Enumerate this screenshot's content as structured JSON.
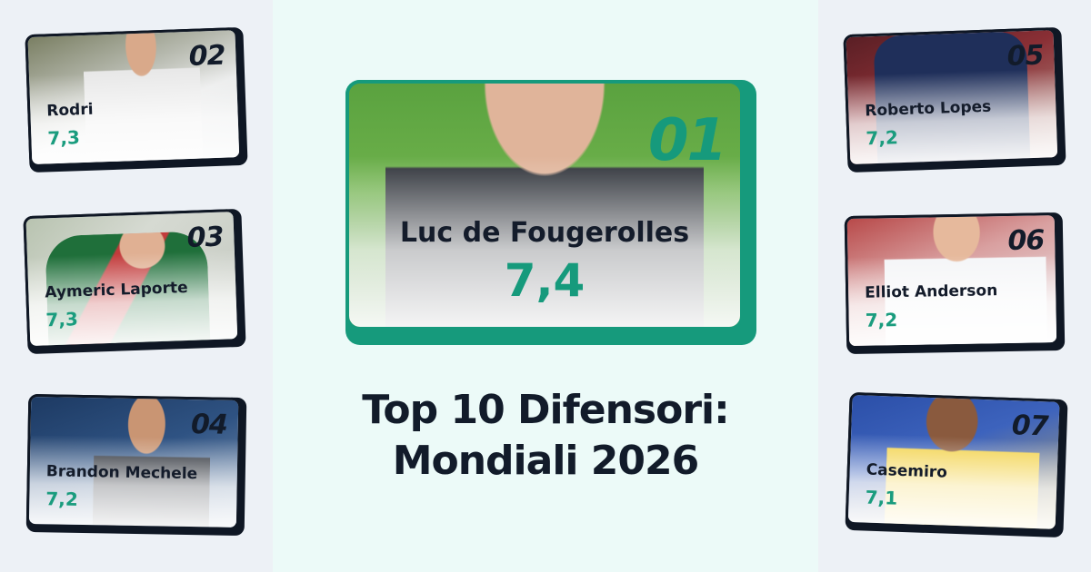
{
  "title": {
    "line1": "Top 10 Difensori:",
    "line2": "Mondiali 2026"
  },
  "featured": {
    "rank": "01",
    "name": "Luc de Fougerolles",
    "score": "7,4"
  },
  "players": [
    {
      "rank": "02",
      "name": "Rodri",
      "score": "7,3"
    },
    {
      "rank": "03",
      "name": "Aymeric Laporte",
      "score": "7,3"
    },
    {
      "rank": "04",
      "name": "Brandon Mechele",
      "score": "7,2"
    },
    {
      "rank": "05",
      "name": "Roberto Lopes",
      "score": "7,2"
    },
    {
      "rank": "06",
      "name": "Elliot Anderson",
      "score": "7,2"
    },
    {
      "rank": "07",
      "name": "Casemiro",
      "score": "7,1"
    }
  ],
  "colors": {
    "accent": "#169a7c",
    "dark": "#121b2a",
    "center_bg": "#ecfaf8",
    "side_bg": "#edf1f6"
  }
}
